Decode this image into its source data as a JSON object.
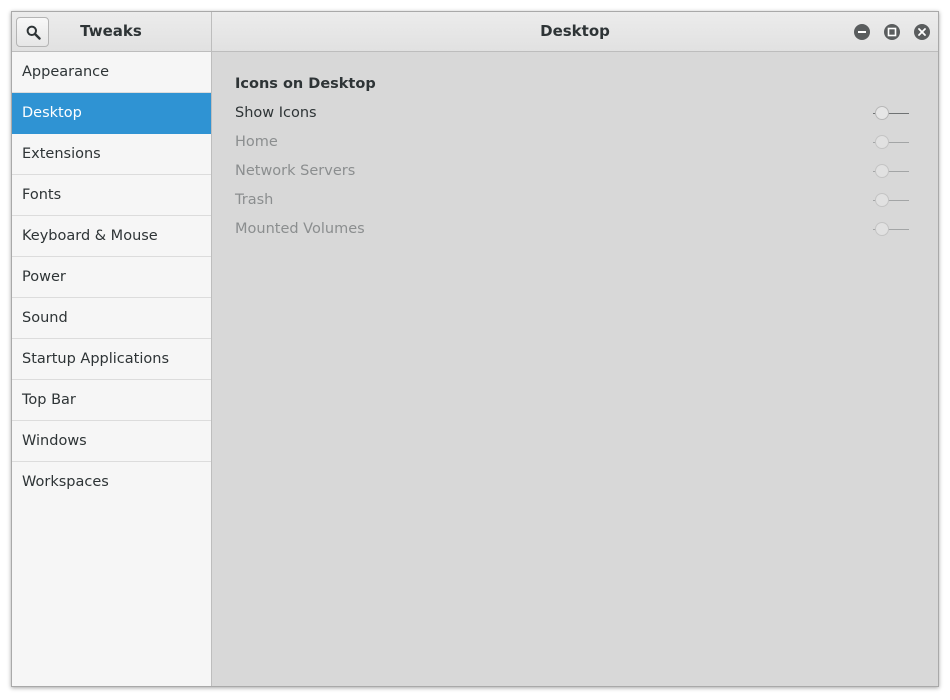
{
  "app_title": "Tweaks",
  "page_title": "Desktop",
  "sidebar": {
    "selected": "Desktop",
    "items": [
      {
        "label": "Appearance"
      },
      {
        "label": "Desktop"
      },
      {
        "label": "Extensions"
      },
      {
        "label": "Fonts"
      },
      {
        "label": "Keyboard & Mouse"
      },
      {
        "label": "Power"
      },
      {
        "label": "Sound"
      },
      {
        "label": "Startup Applications"
      },
      {
        "label": "Top Bar"
      },
      {
        "label": "Windows"
      },
      {
        "label": "Workspaces"
      }
    ]
  },
  "content": {
    "section_title": "Icons on Desktop",
    "settings": [
      {
        "label": "Show Icons",
        "enabled": true,
        "state": "off"
      },
      {
        "label": "Home",
        "enabled": false,
        "state": "off"
      },
      {
        "label": "Network Servers",
        "enabled": false,
        "state": "off"
      },
      {
        "label": "Trash",
        "enabled": false,
        "state": "off"
      },
      {
        "label": "Mounted Volumes",
        "enabled": false,
        "state": "off"
      }
    ]
  },
  "icons": {
    "search": "search-icon",
    "minimize": "minimize-icon",
    "maximize": "maximize-icon",
    "close": "close-icon"
  },
  "colors": {
    "accent": "#2f93d3",
    "content_bg": "#d8d8d8",
    "sidebar_bg": "#f6f6f6",
    "text": "#2e3436",
    "disabled_text": "#8b8e8f"
  }
}
